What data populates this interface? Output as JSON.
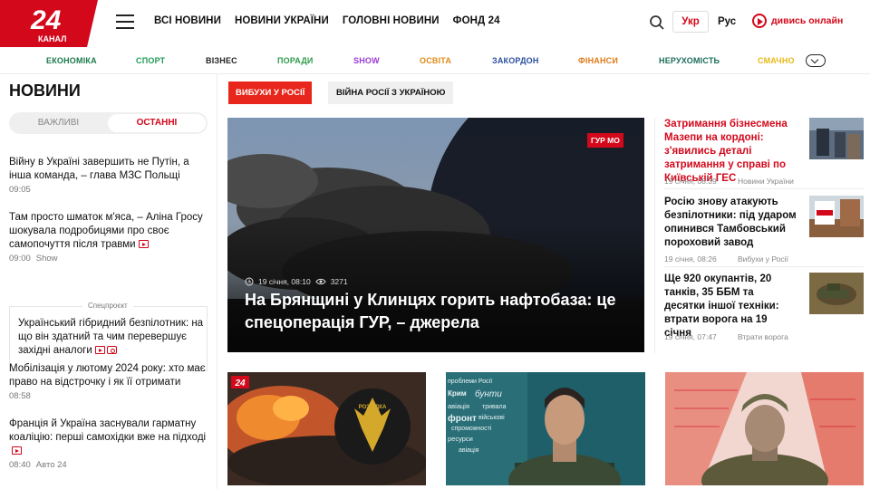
{
  "brand": {
    "logo_number": "24",
    "logo_word": "КАНАЛ",
    "accent": "#d3081b"
  },
  "main_nav": [
    "ВСІ НОВИНИ",
    "НОВИНИ УКРАЇНИ",
    "ГОЛОВНІ НОВИНИ",
    "ФОНД 24"
  ],
  "lang": {
    "active": "Укр",
    "other": "Рус"
  },
  "live_label": "дивись онлайн",
  "categories": [
    {
      "label": "ЕКОНОМІКА",
      "color": "#1a7a4c"
    },
    {
      "label": "СПОРТ",
      "color": "#1e9b57"
    },
    {
      "label": "ВІЗНЕС",
      "color": "#222222"
    },
    {
      "label": "ПОРАДИ",
      "color": "#2d9b4a"
    },
    {
      "label": "SHOW",
      "color": "#9a3bd6"
    },
    {
      "label": "ОСВІТА",
      "color": "#e08a17"
    },
    {
      "label": "ЗАКОРДОН",
      "color": "#2b4f9e"
    },
    {
      "label": "ФІНАНСИ",
      "color": "#e07a17"
    },
    {
      "label": "НЕРУХОМІСТЬ",
      "color": "#1a6d5a"
    },
    {
      "label": "СМАЧНО",
      "color": "#e8b816"
    }
  ],
  "sidebar": {
    "title": "НОВИНИ",
    "tabs": [
      "ВАЖЛИВІ",
      "ОСТАННІ"
    ],
    "news": [
      {
        "title": "Війну в Україні завершить не Путін, а інша команда, – глава МЗС Польщі",
        "time": "09:05",
        "section": ""
      },
      {
        "title": "Там просто шматок м'яса, – Аліна Гросу шокувала подробицями про своє самопочуття після травми",
        "time": "09:00",
        "section": "Show"
      },
      {
        "title": "Мобілізація у лютому 2024 року: хто має право на відстрочку і як її отримати",
        "time": "08:58",
        "section": ""
      },
      {
        "title": "Франція й Україна заснували гарматну коаліцію: перші самохідки вже на підході",
        "time": "08:40",
        "section": "Авто 24"
      }
    ],
    "special_label": "Спецпроєкт",
    "special_title": "Український гібридний безпілотник: на що він здатний та чим перевершує західні аналоги"
  },
  "tags": [
    "ВИБУХИ У РОСІЇ",
    "ВІЙНА РОСІЇ З УКРАЇНОЮ"
  ],
  "hero": {
    "badge": "ГУР МО",
    "date": "19 січня, 08:10",
    "views": "3271",
    "title": "На Брянщині у Клинцях горить нафтобаза: це спецоперація ГУР, – джерела"
  },
  "right_news": [
    {
      "title": "Затримання бізнесмена Мазепи на кордоні: з'явились деталі затримання у справі по Київській ГЕС",
      "date": "19 січня, 08:39",
      "section": "Новини України",
      "highlight": true
    },
    {
      "title": "Росію знову атакують безпілотники: під ударом опинився Тамбовський пороховий завод",
      "date": "19 січня, 08:26",
      "section": "Вибухи у Росії",
      "highlight": false
    },
    {
      "title": "Ще 920 окупантів, 20 танків, 35 ББМ та десятки іншої техніки: втрати ворога на 19 січня",
      "date": "19 січня, 07:47",
      "section": "Втрати ворога",
      "highlight": false
    }
  ],
  "cards": {
    "card1": {
      "logo": "24",
      "emblem_text": "РОЗВІДКА"
    },
    "card2": {
      "words": [
        "проблеми Росії",
        "Крим",
        "бунти",
        "авіація",
        "тривала",
        "фронт",
        "військові",
        "спроможності",
        "ресурси",
        "авіація"
      ]
    }
  }
}
